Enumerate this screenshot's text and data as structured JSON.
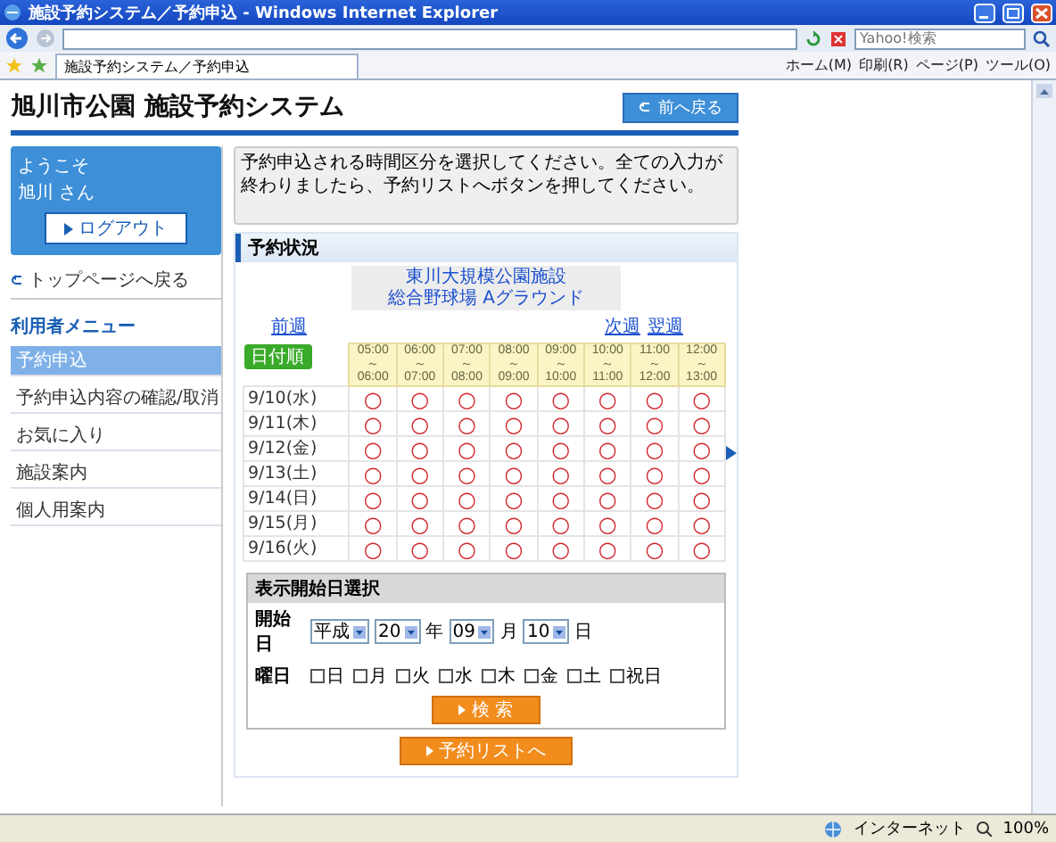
{
  "window": {
    "title": "施設予約システム／予約申込 - Windows Internet Explorer"
  },
  "browser": {
    "search_placeholder": "Yahoo!検索",
    "tab": "施設予約システム／予約申込",
    "commands": [
      "ホーム(M)",
      "印刷(R)",
      "ページ(P)",
      "ツール(O)"
    ]
  },
  "header": {
    "title": "旭川市公園 施設予約システム",
    "back_button": "前へ戻る"
  },
  "user_panel": {
    "greeting": "ようこそ",
    "user": "旭川 さん",
    "logout_button": "ログアウト"
  },
  "top_link": "トップページへ戻る",
  "menu": {
    "title": "利用者メニュー",
    "items": [
      {
        "label": "予約申込",
        "selected": true
      },
      {
        "label": "予約申込内容の確認/取消",
        "selected": false
      },
      {
        "label": "お気に入り",
        "selected": false
      },
      {
        "label": "施設案内",
        "selected": false
      },
      {
        "label": "個人用案内",
        "selected": false
      }
    ]
  },
  "message": "予約申込される時間区分を選択してください。全ての入力が終わりましたら、予約リストへボタンを押してください。",
  "status_section": {
    "title": "予約状況",
    "facility": [
      "東川大規模公園施設",
      "総合野球場 Aグラウンド"
    ],
    "prev_link": "前週",
    "next_links": [
      "次週",
      "翌週"
    ],
    "sort_button": "日付順",
    "time_slots": [
      [
        "05:00",
        "～",
        "06:00"
      ],
      [
        "06:00",
        "～",
        "07:00"
      ],
      [
        "07:00",
        "～",
        "08:00"
      ],
      [
        "08:00",
        "～",
        "09:00"
      ],
      [
        "09:00",
        "～",
        "10:00"
      ],
      [
        "10:00",
        "～",
        "11:00"
      ],
      [
        "11:00",
        "～",
        "12:00"
      ],
      [
        "12:00",
        "～",
        "13:00"
      ]
    ],
    "rows": [
      {
        "date": "9/10(水)",
        "slots": [
          "○",
          "○",
          "○",
          "○",
          "○",
          "○",
          "○",
          "○"
        ]
      },
      {
        "date": "9/11(木)",
        "slots": [
          "○",
          "○",
          "○",
          "○",
          "○",
          "○",
          "○",
          "○"
        ]
      },
      {
        "date": "9/12(金)",
        "slots": [
          "○",
          "○",
          "○",
          "○",
          "○",
          "○",
          "○",
          "○"
        ]
      },
      {
        "date": "9/13(土)",
        "slots": [
          "○",
          "○",
          "○",
          "○",
          "○",
          "○",
          "○",
          "○"
        ]
      },
      {
        "date": "9/14(日)",
        "slots": [
          "○",
          "○",
          "○",
          "○",
          "○",
          "○",
          "○",
          "○"
        ]
      },
      {
        "date": "9/15(月)",
        "slots": [
          "○",
          "○",
          "○",
          "○",
          "○",
          "○",
          "○",
          "○"
        ]
      },
      {
        "date": "9/16(火)",
        "slots": [
          "○",
          "○",
          "○",
          "○",
          "○",
          "○",
          "○",
          "○"
        ]
      }
    ]
  },
  "date_form": {
    "title": "表示開始日選択",
    "start_label": "開始日",
    "selects": [
      {
        "value": "平成"
      },
      {
        "value": "20",
        "unit": "年"
      },
      {
        "value": "09",
        "unit": "月"
      },
      {
        "value": "10",
        "unit": "日"
      }
    ],
    "weekday_label": "曜日",
    "weekdays": [
      {
        "label": "日",
        "checked": false
      },
      {
        "label": "月",
        "checked": false
      },
      {
        "label": "火",
        "checked": false
      },
      {
        "label": "水",
        "checked": false
      },
      {
        "label": "木",
        "checked": false
      },
      {
        "label": "金",
        "checked": false
      },
      {
        "label": "土",
        "checked": false
      },
      {
        "label": "祝日",
        "checked": false
      }
    ],
    "search_button": "検 索"
  },
  "list_button": "予約リストへ",
  "status_bar": {
    "zone": "インターネット",
    "zoom": "100%"
  }
}
